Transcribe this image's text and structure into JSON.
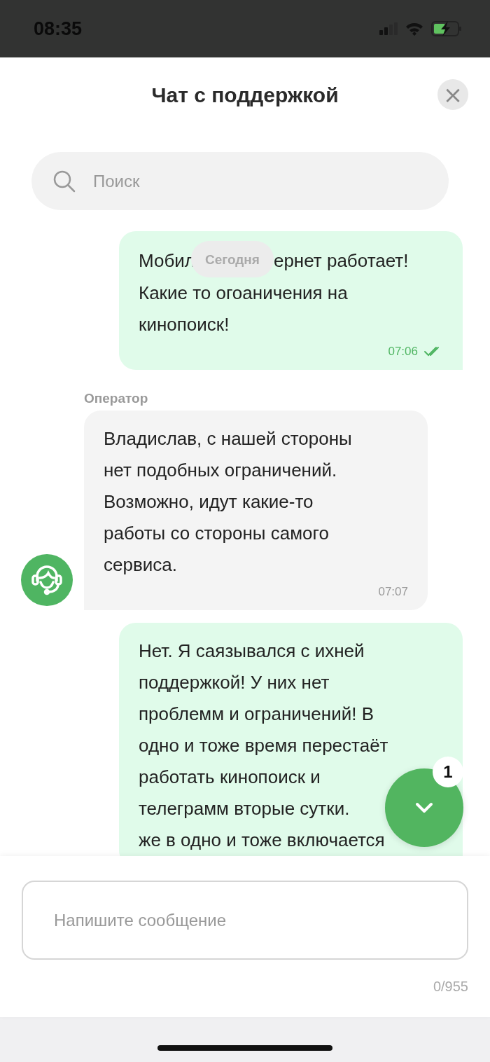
{
  "status_bar": {
    "time": "08:35"
  },
  "header": {
    "title": "Чат с поддержкой",
    "close": "×"
  },
  "search": {
    "placeholder": "Поиск"
  },
  "date_chip": "Сегодня",
  "messages": [
    {
      "kind": "outgoing",
      "first_line": [
        "Мобил",
        "ернет работает!"
      ],
      "lines": [
        "Какие то огоаничения на",
        "кинопоиск!"
      ],
      "time": "07:06",
      "read": true
    },
    {
      "kind": "incoming",
      "sender": "Оператор",
      "lines": [
        "Владислав, с нашей стороны",
        "нет подобных ограничений.",
        "Возможно, идут какие-то",
        "работы со стороны самого",
        "сервиса."
      ],
      "time": "07:07"
    },
    {
      "kind": "outgoing",
      "lines": [
        "Нет. Я саязывался с ихней",
        "поддержкой! У них нет",
        "проблемм и ограничений! В",
        "одно и тоже время перестаёт",
        "работать кинопоиск и",
        "телеграмм вторые сутки.",
        "же в одно и тоже включается"
      ]
    }
  ],
  "scroll_button": {
    "badge": "1"
  },
  "composer": {
    "placeholder": "Напишите сообщение",
    "counter": "0/955"
  }
}
